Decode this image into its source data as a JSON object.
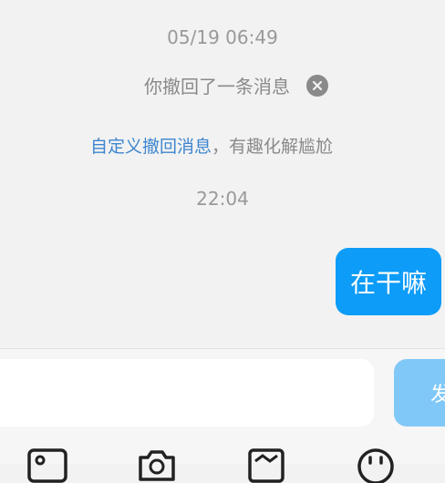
{
  "messages": {
    "timestamp_1": "05/19 06:49",
    "recall_notice": "你撤回了一条消息",
    "custom_recall_link": "自定义撤回消息",
    "custom_recall_rest": "，有趣化解尴尬",
    "timestamp_2": "22:04",
    "sent_message": "在干嘛"
  },
  "composer": {
    "input_value": "",
    "send_label": "发"
  },
  "toolbar": {
    "icons": [
      "image-icon",
      "camera-icon",
      "album-icon",
      "emoji-icon"
    ]
  },
  "colors": {
    "bubble": "#0d9cf8",
    "link": "#3e86cf",
    "send_disabled": "#80c8f7"
  }
}
